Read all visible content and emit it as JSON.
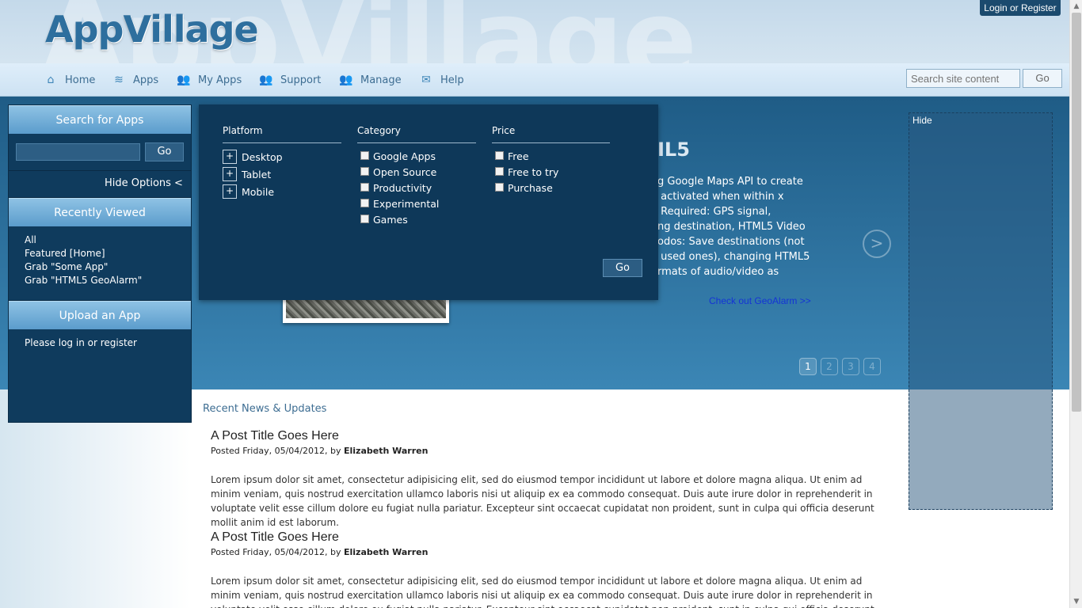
{
  "header": {
    "watermark": "AppVillage",
    "logo": "AppVillage",
    "login_label": "Login or Register"
  },
  "nav": {
    "items": [
      {
        "label": "Home",
        "icon": "home-icon"
      },
      {
        "label": "Apps",
        "icon": "apps-icon"
      },
      {
        "label": "My Apps",
        "icon": "users-icon"
      },
      {
        "label": "Support",
        "icon": "users-icon"
      },
      {
        "label": "Manage",
        "icon": "users-icon"
      },
      {
        "label": "Help",
        "icon": "mail-icon"
      }
    ],
    "search_placeholder": "Search site content",
    "search_go": "Go"
  },
  "sidebar": {
    "search_title": "Search for Apps",
    "search_go": "Go",
    "hide_options": "Hide Options  <",
    "recently_viewed_title": "Recently Viewed",
    "recent_items": [
      "All",
      "Featured [Home]",
      "Grab \"Some App\"",
      "Grab \"HTML5 GeoAlarm\""
    ],
    "upload_title": "Upload an App",
    "upload_text": "Please log in or register"
  },
  "dropdown": {
    "platform_head": "Platform",
    "platform_items": [
      "Desktop",
      "Tablet",
      "Mobile"
    ],
    "category_head": "Category",
    "category_items": [
      "Google Apps",
      "Open Source",
      "Productivity",
      "Experimental",
      "Games"
    ],
    "price_head": "Price",
    "price_items": [
      "Free",
      "Free to try",
      "Purchase"
    ],
    "go": "Go"
  },
  "hero": {
    "title": "IL5",
    "text": "g Google Maps API to create\n activated when within x\n Required: GPS signal,\nng destination, HTML5 Video\nodos: Save destinations (not\n used ones), changing HTML5\nrmats of audio/video as",
    "link": "Check out GeoAlarm >>",
    "arrow": ">",
    "pages": [
      "1",
      "2",
      "3",
      "4"
    ],
    "active_page": "1"
  },
  "hide_panel": {
    "label": "Hide"
  },
  "news": {
    "heading": "Recent News & Updates",
    "posts": [
      {
        "title": "A Post Title Goes Here",
        "meta_prefix": "Posted Friday, 05/04/2012, by ",
        "author": "Elizabeth Warren",
        "body": "Lorem ipsum dolor sit amet, consectetur adipisicing elit, sed do eiusmod tempor incididunt ut labore et dolore magna aliqua. Ut enim ad minim veniam, quis nostrud exercitation ullamco laboris nisi ut aliquip ex ea commodo consequat. Duis aute irure dolor in reprehenderit in voluptate velit esse cillum dolore eu fugiat nulla pariatur. Excepteur sint occaecat cupidatat non proident, sunt in culpa qui officia deserunt mollit anim id est laborum."
      },
      {
        "title": "A Post Title Goes Here",
        "meta_prefix": "Posted Friday, 05/04/2012, by ",
        "author": "Elizabeth Warren",
        "body": "Lorem ipsum dolor sit amet, consectetur adipisicing elit, sed do eiusmod tempor incididunt ut labore et dolore magna aliqua. Ut enim ad minim veniam, quis nostrud exercitation ullamco laboris nisi ut aliquip ex ea commodo consequat. Duis aute irure dolor in reprehenderit in voluptate velit esse cillum dolore eu fugiat nulla pariatur. Excepteur sint occaecat cupidatat non proident, sunt in culpa qui officia deserunt mollit anim id est laborum."
      }
    ]
  },
  "colors": {
    "brand": "#2e6f9e",
    "sidebar_bg": "#0f3b5d",
    "dropdown_bg": "#0e3859",
    "link": "#1433d6"
  }
}
